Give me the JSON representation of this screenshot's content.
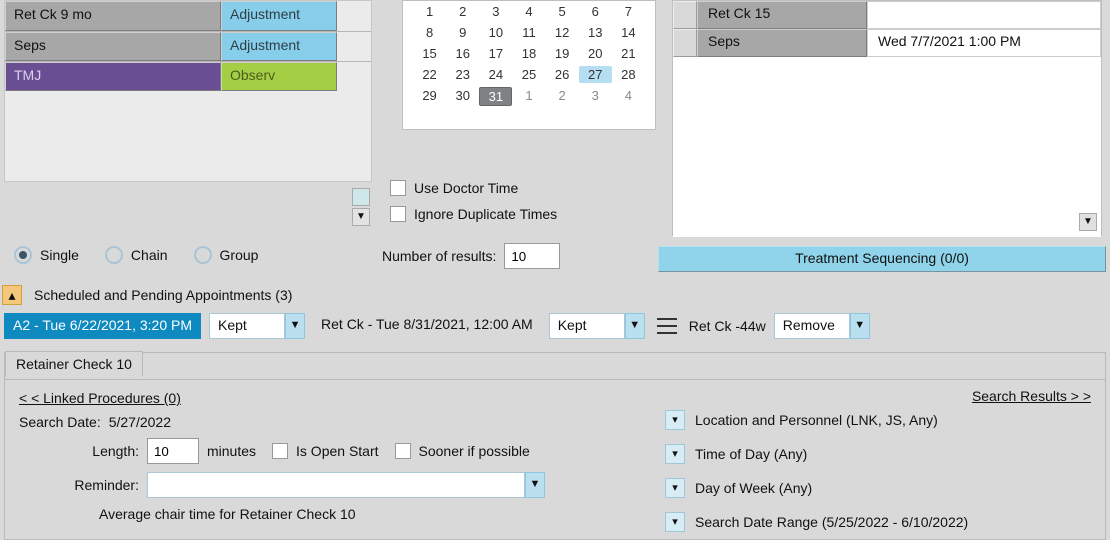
{
  "proc_list": [
    {
      "name": "Ret Ck 9 mo",
      "tag": "Adjustment",
      "name_style": "",
      "tag_style": ""
    },
    {
      "name": "Seps",
      "tag": "Adjustment",
      "name_style": "",
      "tag_style": ""
    },
    {
      "name": "TMJ",
      "tag": "Observ",
      "name_style": "purple",
      "tag_style": "green"
    }
  ],
  "radios": {
    "single": "Single",
    "chain": "Chain",
    "group": "Group"
  },
  "calendar": {
    "rows": [
      [
        {
          "d": "1"
        },
        {
          "d": "2"
        },
        {
          "d": "3"
        },
        {
          "d": "4"
        },
        {
          "d": "5"
        },
        {
          "d": "6"
        },
        {
          "d": "7"
        }
      ],
      [
        {
          "d": "8"
        },
        {
          "d": "9"
        },
        {
          "d": "10"
        },
        {
          "d": "11"
        },
        {
          "d": "12"
        },
        {
          "d": "13"
        },
        {
          "d": "14"
        }
      ],
      [
        {
          "d": "15"
        },
        {
          "d": "16"
        },
        {
          "d": "17"
        },
        {
          "d": "18"
        },
        {
          "d": "19"
        },
        {
          "d": "20"
        },
        {
          "d": "21"
        }
      ],
      [
        {
          "d": "22"
        },
        {
          "d": "23"
        },
        {
          "d": "24"
        },
        {
          "d": "25"
        },
        {
          "d": "26"
        },
        {
          "d": "27",
          "hl": true
        },
        {
          "d": "28"
        }
      ],
      [
        {
          "d": "29"
        },
        {
          "d": "30"
        },
        {
          "d": "31",
          "today": true
        },
        {
          "d": "1",
          "dim": true
        },
        {
          "d": "2",
          "dim": true
        },
        {
          "d": "3",
          "dim": true
        },
        {
          "d": "4",
          "dim": true
        }
      ]
    ]
  },
  "options": {
    "use_doctor_time": "Use Doctor Time",
    "ignore_dup": "Ignore Duplicate Times",
    "num_results_label": "Number of results:",
    "num_results_value": "10"
  },
  "appt_list": [
    {
      "name": "Ret Ck 15",
      "date": ""
    },
    {
      "name": "Seps",
      "date": "Wed 7/7/2021 1:00 PM"
    }
  ],
  "treatment_sequencing": "Treatment Sequencing (0/0)",
  "collapse_header": "Scheduled and Pending Appointments (3)",
  "sched": {
    "a2": "A2 - Tue 6/22/2021, 3:20 PM",
    "kept1": "Kept",
    "retck_text": "Ret Ck - Tue 8/31/2021, 12:00 AM",
    "kept2": "Kept",
    "retck44": "Ret Ck -44w",
    "remove": "Remove"
  },
  "tab": {
    "title": "Retainer Check 10",
    "linked_proc": "< < Linked Procedures (0)",
    "search_results": "Search Results > >",
    "search_date_label": "Search Date:",
    "search_date_value": "5/27/2022",
    "length_label": "Length:",
    "length_value": "10",
    "minutes": "minutes",
    "is_open_start": "Is Open Start",
    "sooner": "Sooner if possible",
    "reminder_label": "Reminder:",
    "avg_chair": "Average chair time for Retainer Check 10",
    "right": {
      "location": "Location and Personnel (LNK, JS, Any)",
      "tod": "Time of Day (Any)",
      "dow": "Day of Week (Any)",
      "range": "Search Date Range (5/25/2022 - 6/10/2022)"
    }
  }
}
